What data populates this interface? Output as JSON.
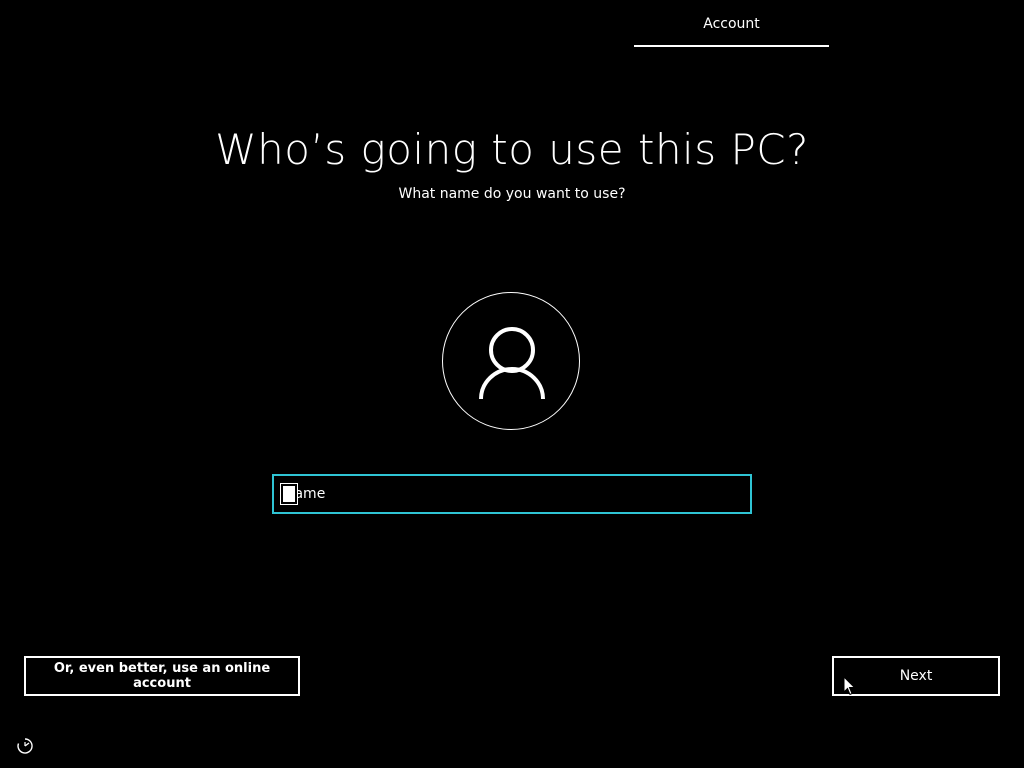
{
  "header": {
    "section_tab": "Account"
  },
  "main": {
    "title": "Who’s going to use this PC?",
    "subtitle": "What name do you want to use?",
    "avatar_icon": "user-icon",
    "name_field": {
      "placeholder": "Name",
      "value": ""
    }
  },
  "footer": {
    "online_account_label": "Or, even better, use an online account",
    "next_label": "Next",
    "accessibility_icon": "ease-of-access-icon"
  },
  "colors": {
    "background": "#000000",
    "foreground": "#ffffff",
    "focus_border": "#2fc4d4"
  }
}
